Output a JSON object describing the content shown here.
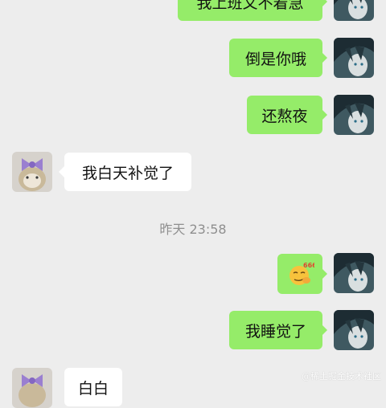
{
  "colors": {
    "background": "#ededed",
    "my_bubble": "#95ec69",
    "their_bubble": "#ffffff",
    "timestamp_text": "#8f8f8f"
  },
  "messages": [
    {
      "side": "me",
      "text": "我上班又不着急"
    },
    {
      "side": "me",
      "text": "倒是你哦"
    },
    {
      "side": "me",
      "text": "还熬夜"
    },
    {
      "side": "them",
      "text": "我白天补觉了"
    },
    {
      "side": "me",
      "type": "sticker",
      "icon": "666-emoji-icon",
      "sticker_text": "666"
    },
    {
      "side": "me",
      "text": "我睡觉了"
    },
    {
      "side": "them",
      "text": "白白"
    }
  ],
  "timestamp": "昨天 23:58",
  "watermark": "@稀土掘金技术社区",
  "avatars": {
    "me": "anime-character-avatar",
    "them": "cat-with-purple-bow-avatar"
  }
}
